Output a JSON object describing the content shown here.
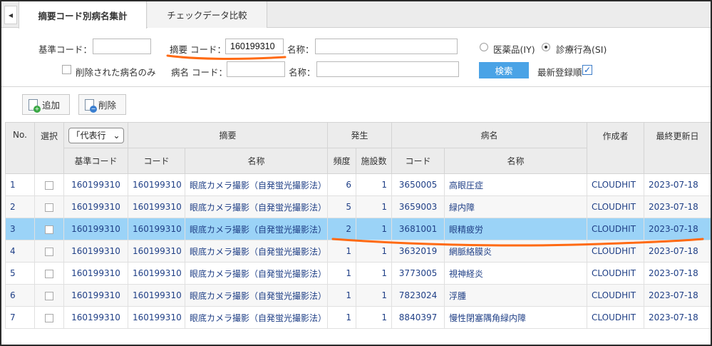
{
  "tabs": [
    {
      "label": "摘要コード別病名集計",
      "active": true
    },
    {
      "label": "チェックデータ比較",
      "active": false
    }
  ],
  "search": {
    "base_code_label": "基準コード：",
    "base_code_value": "",
    "summary_code_label": "摘要 コード：",
    "summary_code_value": "160199310",
    "summary_name_label": "名称：",
    "summary_name_value": "",
    "deleted_only_label": "削除された病名のみ",
    "disease_code_label": "病名 コード：",
    "disease_code_value": "",
    "disease_name_label": "名称：",
    "disease_name_value": "",
    "radio_drug_label": "医薬品(IY)",
    "radio_procedure_label": "診療行為(SI)",
    "search_button_label": "検索",
    "latest_order_label": "最新登録順",
    "latest_order_checked": true
  },
  "toolbar": {
    "add_label": "追加",
    "delete_label": "削除"
  },
  "table": {
    "headers": {
      "no": "No.",
      "select": "選択",
      "representative_option": "「代表行",
      "summary_group": "摘要",
      "occurrence_group": "発生",
      "disease_group": "病名",
      "author": "作成者",
      "last_updated": "最終更新日",
      "base_code": "基準コード",
      "summary_code": "コード",
      "summary_name": "名称",
      "frequency": "頻度",
      "facility_count": "施設数",
      "disease_code": "コード",
      "disease_name": "名称"
    },
    "rows": [
      {
        "no": "1",
        "base_code": "160199310",
        "summary_code": "160199310",
        "summary_name": "眼底カメラ撮影（自発蛍光撮影法）",
        "frequency": "6",
        "facility_count": "1",
        "disease_code": "3650005",
        "disease_name": "高眼圧症",
        "author": "CLOUDHIT",
        "last_updated": "2023-07-18"
      },
      {
        "no": "2",
        "base_code": "160199310",
        "summary_code": "160199310",
        "summary_name": "眼底カメラ撮影（自発蛍光撮影法）",
        "frequency": "5",
        "facility_count": "1",
        "disease_code": "3659003",
        "disease_name": "緑内障",
        "author": "CLOUDHIT",
        "last_updated": "2023-07-18"
      },
      {
        "no": "3",
        "base_code": "160199310",
        "summary_code": "160199310",
        "summary_name": "眼底カメラ撮影（自発蛍光撮影法）",
        "frequency": "2",
        "facility_count": "1",
        "disease_code": "3681001",
        "disease_name": "眼精疲労",
        "author": "CLOUDHIT",
        "last_updated": "2023-07-18"
      },
      {
        "no": "4",
        "base_code": "160199310",
        "summary_code": "160199310",
        "summary_name": "眼底カメラ撮影（自発蛍光撮影法）",
        "frequency": "1",
        "facility_count": "1",
        "disease_code": "3632019",
        "disease_name": "網脈絡膜炎",
        "author": "CLOUDHIT",
        "last_updated": "2023-07-18"
      },
      {
        "no": "5",
        "base_code": "160199310",
        "summary_code": "160199310",
        "summary_name": "眼底カメラ撮影（自発蛍光撮影法）",
        "frequency": "1",
        "facility_count": "1",
        "disease_code": "3773005",
        "disease_name": "視神経炎",
        "author": "CLOUDHIT",
        "last_updated": "2023-07-18"
      },
      {
        "no": "6",
        "base_code": "160199310",
        "summary_code": "160199310",
        "summary_name": "眼底カメラ撮影（自発蛍光撮影法）",
        "frequency": "1",
        "facility_count": "1",
        "disease_code": "7823024",
        "disease_name": "浮腫",
        "author": "CLOUDHIT",
        "last_updated": "2023-07-18"
      },
      {
        "no": "7",
        "base_code": "160199310",
        "summary_code": "160199310",
        "summary_name": "眼底カメラ撮影（自発蛍光撮影法）",
        "frequency": "1",
        "facility_count": "1",
        "disease_code": "8840397",
        "disease_name": "慢性閉塞隅角緑内障",
        "author": "CLOUDHIT",
        "last_updated": "2023-07-18"
      }
    ],
    "selected_row_index": 2
  },
  "colors": {
    "selected_row": "#9bd3f7",
    "search_button": "#4aa3e6",
    "annotation": "#ff6a13",
    "link_text": "#1f3f86"
  }
}
